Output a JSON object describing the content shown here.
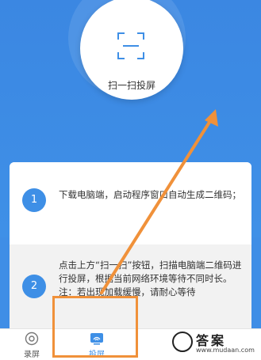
{
  "scan": {
    "label": "扫一扫投屏"
  },
  "steps": [
    {
      "num": "1",
      "text": "下载电脑端，启动程序窗口自动生成二维码；"
    },
    {
      "num": "2",
      "text": "点击上方“扫一扫”按钮，扫描电脑端二维码进行投屏，根据当前网络环境等待不同时长。注：若出现加载缓慢，请耐心等待"
    }
  ],
  "tabbar": {
    "record_label": "录屏",
    "cast_label": "投屏"
  },
  "watermark": {
    "title": "答案",
    "url": "www.mudaan.com"
  },
  "colors": {
    "accent": "#3e8fe6",
    "highlight": "#f0913a"
  },
  "icons": [
    "scan-icon",
    "record-icon",
    "cast-icon"
  ]
}
